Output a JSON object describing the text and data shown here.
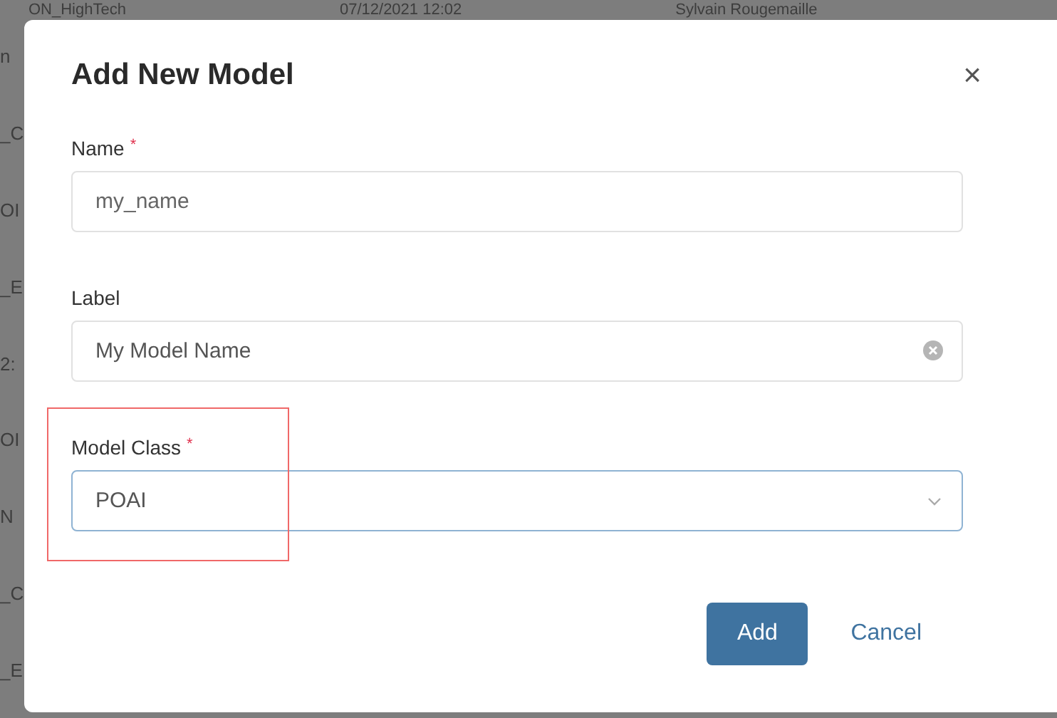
{
  "background_table": {
    "top_row": [
      "ON_HighTech",
      "07/12/2021 12:02",
      "Sylvain Rougemaille"
    ],
    "left_column": [
      "n",
      "_C",
      "OI",
      "_E",
      "2:",
      "OI",
      "N",
      "_C",
      "_E"
    ]
  },
  "dialog": {
    "title": "Add New Model",
    "close": "×",
    "fields": [
      {
        "kind": "text",
        "label": "Name",
        "required_mark": "*",
        "placeholder": "my_name",
        "clearable": false,
        "highlighted": false
      },
      {
        "kind": "text",
        "label": "Label",
        "value": "My Model Name",
        "clearable": true,
        "highlighted": false
      },
      {
        "kind": "select",
        "label": "Model Class",
        "required_mark": "*",
        "value": "POAI",
        "highlighted": true
      }
    ],
    "buttons": [
      {
        "label": "Add",
        "kind": "primary"
      },
      {
        "label": "Cancel",
        "kind": "link"
      }
    ]
  }
}
